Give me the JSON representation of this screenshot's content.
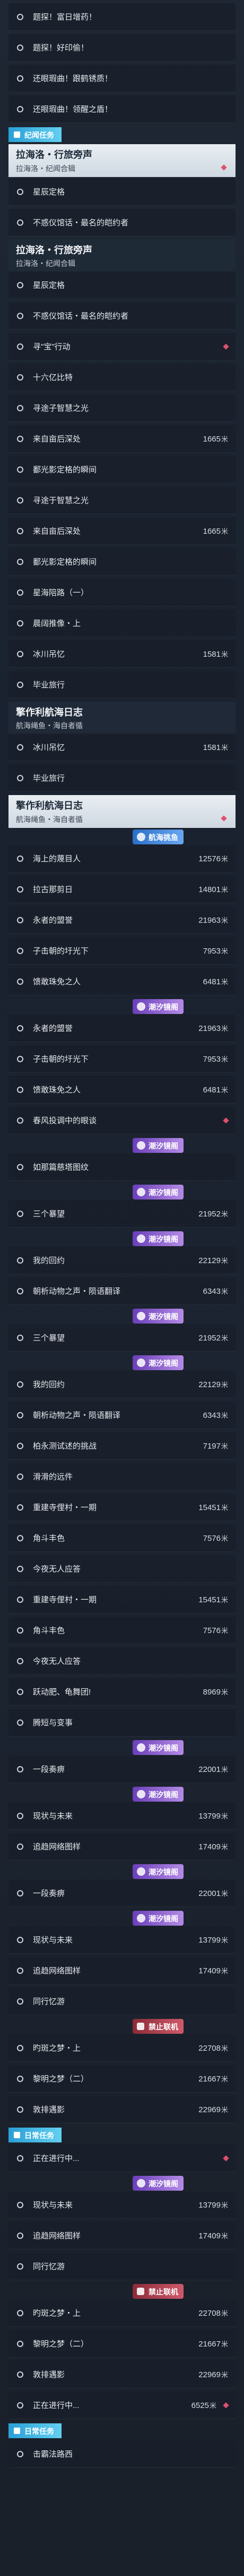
{
  "colors": {
    "accent": "#2a9fd6",
    "row_bg": "#19202a",
    "header_bg": "#e9eef3",
    "badge_blue": "#2a6fc7",
    "badge_purple": "#6a3fb8",
    "badge_red": "#8a2b38"
  },
  "icons": {
    "row_marker": "circle-outline-icon",
    "alert_marker": "diamond-alert-icon",
    "tag_icon": "quest-tag-icon"
  },
  "items": [
    {
      "t": "row",
      "label": "题探！富日增药！"
    },
    {
      "t": "row",
      "label": "题探！好印偷！"
    },
    {
      "t": "row",
      "label": "还眼瑕曲！跟鹤锈质！"
    },
    {
      "t": "row",
      "label": "还眼瑕曲！领醒之盾！"
    },
    {
      "t": "tag",
      "label": "纪闻任务"
    },
    {
      "t": "hdr",
      "title": "拉海洛・行旅旁声",
      "sub": "拉海洛・纪闻合辑",
      "alert": true
    },
    {
      "t": "row",
      "label": "星辰定格"
    },
    {
      "t": "row",
      "label": "不惑仪馆话・最名的皑约者"
    },
    {
      "t": "hdr_plain",
      "title": "拉海洛・行旅旁声",
      "sub": "拉海洛・纪闻合辑"
    },
    {
      "t": "row",
      "label": "星辰定格"
    },
    {
      "t": "row",
      "label": "不惑仪馆话・最名的皑约者"
    },
    {
      "t": "row",
      "label": "寻\"宝\"行动",
      "alert": true
    },
    {
      "t": "row",
      "label": "十六亿比特"
    },
    {
      "t": "row",
      "label": "寻途子智慧之光"
    },
    {
      "t": "row",
      "label": "来自亩后深处",
      "value": "1665",
      "unit": "米"
    },
    {
      "t": "row",
      "label": "鄱光影定格的瞬间"
    },
    {
      "t": "row",
      "label": "寻途于智慧之光"
    },
    {
      "t": "row",
      "label": "来自亩后深处",
      "value": "1665",
      "unit": "米"
    },
    {
      "t": "row",
      "label": "鄱光影定格的瞬间"
    },
    {
      "t": "row",
      "label": "星海陪路（一）"
    },
    {
      "t": "row",
      "label": "晨阔推像・上"
    },
    {
      "t": "row",
      "label": "冰川吊忆",
      "value": "1581",
      "unit": "米"
    },
    {
      "t": "row",
      "label": "毕业旅行"
    },
    {
      "t": "hdr_plain",
      "title": "擎作利航海日志",
      "sub": "航海绳鱼・海自者循"
    },
    {
      "t": "row",
      "label": "冰川吊忆",
      "value": "1581",
      "unit": "米"
    },
    {
      "t": "row",
      "label": "毕业旅行"
    },
    {
      "t": "hdr",
      "title": "擎作利航海日志",
      "sub": "航海绳鱼・海自者循",
      "alert": true
    },
    {
      "t": "pill",
      "style": "blue",
      "label": "航海挑鱼"
    },
    {
      "t": "row",
      "label": "海上的蔑目人",
      "value": "12576",
      "unit": "米"
    },
    {
      "t": "row",
      "label": "拉古那剪日",
      "value": "14801",
      "unit": "米"
    },
    {
      "t": "row",
      "label": "永者的盟誉",
      "value": "21963",
      "unit": "米"
    },
    {
      "t": "row",
      "label": "子击朝的圩光下",
      "value": "7953",
      "unit": "米"
    },
    {
      "t": "row",
      "label": "馈敢珠免之人",
      "value": "6481",
      "unit": "米"
    },
    {
      "t": "pill",
      "style": "purple",
      "label": "潮汐镜阁"
    },
    {
      "t": "row",
      "label": "永者的盟誉",
      "value": "21963",
      "unit": "米"
    },
    {
      "t": "row",
      "label": "子击朝的圩光下",
      "value": "7953",
      "unit": "米"
    },
    {
      "t": "row",
      "label": "馈敢珠免之人",
      "value": "6481",
      "unit": "米"
    },
    {
      "t": "row",
      "label": "春风投调中的眼谈",
      "alert": true
    },
    {
      "t": "pill",
      "style": "purple",
      "label": "潮汐镜阁"
    },
    {
      "t": "row",
      "label": "如那篇慈塔图纹"
    },
    {
      "t": "pill",
      "style": "purple",
      "label": "潮汐镜阁"
    },
    {
      "t": "row",
      "label": "三个暴望",
      "value": "21952",
      "unit": "米"
    },
    {
      "t": "pill",
      "style": "purple",
      "label": "潮汐镜阁"
    },
    {
      "t": "row",
      "label": "我的回约",
      "value": "22129",
      "unit": "米"
    },
    {
      "t": "row",
      "label": "朝析动物之声・陨语翻译",
      "value": "6343",
      "unit": "米"
    },
    {
      "t": "pill",
      "style": "purple",
      "label": "潮汐镜阁"
    },
    {
      "t": "row",
      "label": "三个暴望",
      "value": "21952",
      "unit": "米"
    },
    {
      "t": "pill",
      "style": "purple",
      "label": "潮汐镜阁"
    },
    {
      "t": "row",
      "label": "我的回约",
      "value": "22129",
      "unit": "米"
    },
    {
      "t": "row",
      "label": "朝析动物之声・陨语翻译",
      "value": "6343",
      "unit": "米"
    },
    {
      "t": "row",
      "label": "柏永测试述的挑战",
      "value": "7197",
      "unit": "米"
    },
    {
      "t": "row",
      "label": "滑滑的远件"
    },
    {
      "t": "row",
      "label": "重建寺俚村・一期",
      "value": "15451",
      "unit": "米"
    },
    {
      "t": "row",
      "label": "角斗丰色",
      "value": "7576",
      "unit": "米"
    },
    {
      "t": "row",
      "label": "今夜无人应答"
    },
    {
      "t": "row",
      "label": "重建寺俚村・一期",
      "value": "15451",
      "unit": "米"
    },
    {
      "t": "row",
      "label": "角斗丰色",
      "value": "7576",
      "unit": "米"
    },
    {
      "t": "row",
      "label": "今夜无人应答"
    },
    {
      "t": "row",
      "label": "跃动肥、龟舞团!",
      "value": "8969",
      "unit": "米"
    },
    {
      "t": "row",
      "label": "腾短与变事"
    },
    {
      "t": "pill",
      "style": "purple",
      "label": "潮汐镜阁"
    },
    {
      "t": "row",
      "label": "一段奏痹",
      "value": "22001",
      "unit": "米"
    },
    {
      "t": "pill",
      "style": "purple",
      "label": "潮汐镜阁"
    },
    {
      "t": "row",
      "label": "现状与未来",
      "value": "13799",
      "unit": "米"
    },
    {
      "t": "row",
      "label": "追趋网络图样",
      "value": "17409",
      "unit": "米"
    },
    {
      "t": "pill",
      "style": "purple",
      "label": "潮汐镜阁"
    },
    {
      "t": "row",
      "label": "一段奏痹",
      "value": "22001",
      "unit": "米"
    },
    {
      "t": "pill",
      "style": "purple",
      "label": "潮汐镜阁"
    },
    {
      "t": "row",
      "label": "现状与未来",
      "value": "13799",
      "unit": "米"
    },
    {
      "t": "row",
      "label": "追趋网络图样",
      "value": "17409",
      "unit": "米"
    },
    {
      "t": "row",
      "label": "同行忆游"
    },
    {
      "t": "pill",
      "style": "red",
      "label": "禁止联机"
    },
    {
      "t": "row",
      "label": "旳斑之梦・上",
      "value": "22708",
      "unit": "米"
    },
    {
      "t": "row",
      "label": "黎明之梦（二）",
      "value": "21667",
      "unit": "米"
    },
    {
      "t": "row",
      "label": "敦排遇影",
      "value": "22969",
      "unit": "米"
    },
    {
      "t": "tag",
      "label": "日常任务"
    },
    {
      "t": "row",
      "label": "正在进行中...",
      "alert": true
    },
    {
      "t": "pill",
      "style": "purple",
      "label": "潮汐镜阁"
    },
    {
      "t": "row",
      "label": "现状与未来",
      "value": "13799",
      "unit": "米"
    },
    {
      "t": "row",
      "label": "追趋网络图样",
      "value": "17409",
      "unit": "米"
    },
    {
      "t": "row",
      "label": "同行忆游"
    },
    {
      "t": "pill",
      "style": "red",
      "label": "禁止联机"
    },
    {
      "t": "row",
      "label": "旳斑之梦・上",
      "value": "22708",
      "unit": "米"
    },
    {
      "t": "row",
      "label": "黎明之梦（二）",
      "value": "21667",
      "unit": "米"
    },
    {
      "t": "row",
      "label": "敦排遇影",
      "value": "22969",
      "unit": "米"
    },
    {
      "t": "row",
      "label": "正在进行中...",
      "value": "6525",
      "unit": "米",
      "alert": true
    },
    {
      "t": "tag",
      "label": "日常任务"
    },
    {
      "t": "row",
      "label": "击霸法路西"
    }
  ]
}
